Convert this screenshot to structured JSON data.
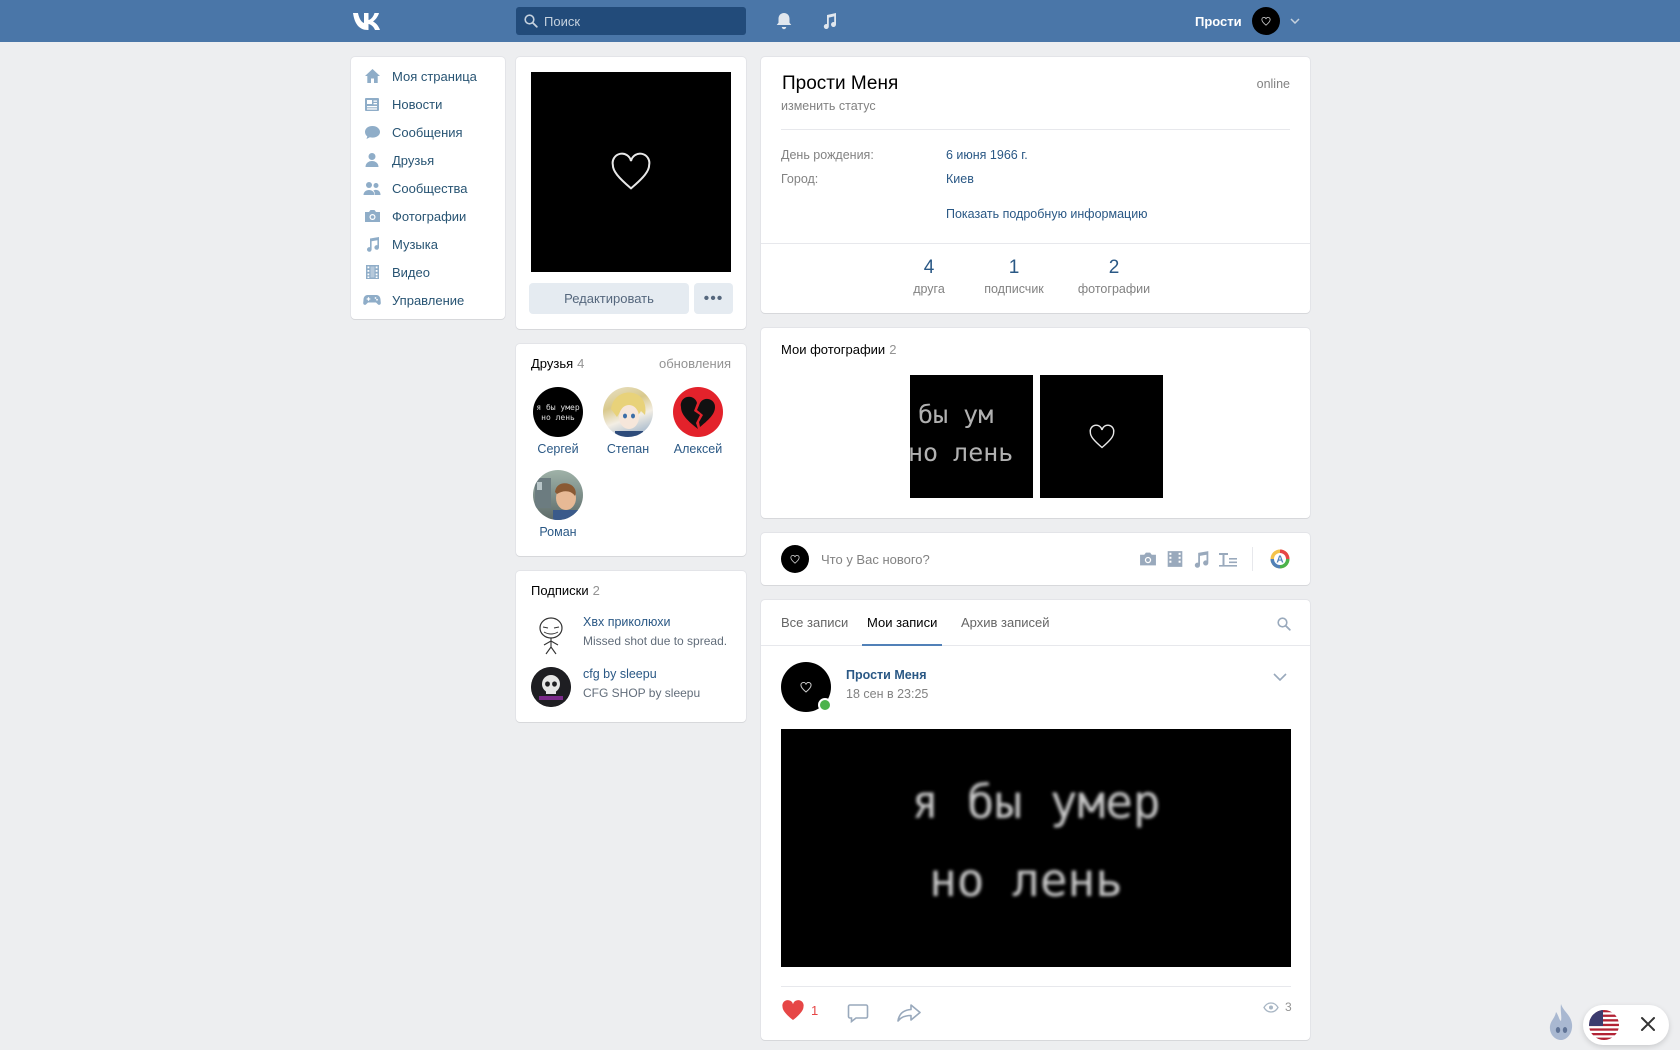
{
  "header": {
    "search_placeholder": "Поиск",
    "user_name": "Прости"
  },
  "nav": {
    "items": [
      {
        "label": "Моя страница",
        "icon": "home-icon"
      },
      {
        "label": "Новости",
        "icon": "news-icon"
      },
      {
        "label": "Сообщения",
        "icon": "messages-icon"
      },
      {
        "label": "Друзья",
        "icon": "friends-icon"
      },
      {
        "label": "Сообщества",
        "icon": "communities-icon"
      },
      {
        "label": "Фотографии",
        "icon": "camera-icon"
      },
      {
        "label": "Музыка",
        "icon": "music-icon"
      },
      {
        "label": "Видео",
        "icon": "video-icon"
      },
      {
        "label": "Управление",
        "icon": "gamepad-icon"
      }
    ]
  },
  "profile": {
    "edit_label": "Редактировать",
    "more_label": "•••",
    "name": "Прости Меня",
    "status_placeholder": "изменить статус",
    "online": "online",
    "info": [
      {
        "label": "День рождения:",
        "value": "6 июня 1966 г."
      },
      {
        "label": "Город:",
        "value": "Киев"
      }
    ],
    "show_more": "Показать подробную информацию",
    "counters": [
      {
        "num": "4",
        "label": "друга"
      },
      {
        "num": "1",
        "label": "подписчик"
      },
      {
        "num": "2",
        "label": "фотографии"
      }
    ]
  },
  "friends": {
    "title": "Друзья",
    "count": "4",
    "updates": "обновления",
    "list": [
      {
        "name": "Сергей"
      },
      {
        "name": "Степан"
      },
      {
        "name": "Алексей"
      },
      {
        "name": "Роман"
      }
    ]
  },
  "subscriptions": {
    "title": "Подписки",
    "count": "2",
    "list": [
      {
        "name": "Xвх приколюхи",
        "desc": "Missed shot due to spread."
      },
      {
        "name": "cfg by sleepu",
        "desc": "CFG SHOP by sleepu"
      }
    ]
  },
  "photos": {
    "title": "Мои фотографии",
    "count": "2",
    "photo1_text": "бы ум\nно лень"
  },
  "composer": {
    "placeholder": "Что у Вас нового?"
  },
  "wall": {
    "tabs": [
      "Все записи",
      "Мои записи",
      "Архив записей"
    ],
    "active_tab": 1,
    "post": {
      "author": "Прости Меня",
      "date": "18 сен в 23:25",
      "image_line1": "я бы умер",
      "image_line2": "но лень",
      "likes": "1",
      "views": "3"
    }
  },
  "colors": {
    "header": "#4a76a8",
    "link": "#2a5885",
    "like": "#e64646"
  }
}
